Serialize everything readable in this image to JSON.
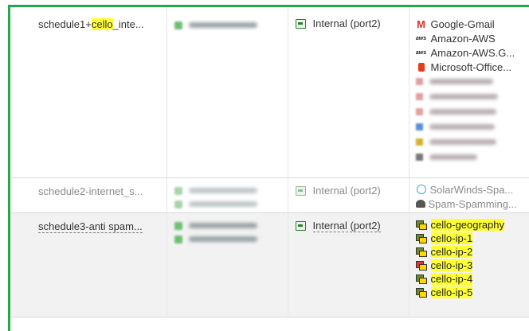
{
  "policies": [
    {
      "name_prefix": "schedule1+",
      "name_highlight": "cello",
      "name_suffix": "_inte...",
      "interface": "Internal (port2)",
      "services": [
        {
          "icon": "gmail-icon",
          "label": "Google-Gmail"
        },
        {
          "icon": "aws-icon",
          "label": "Amazon-AWS"
        },
        {
          "icon": "aws-icon",
          "label": "Amazon-AWS.G..."
        },
        {
          "icon": "office-icon",
          "label": "Microsoft-Office..."
        }
      ]
    },
    {
      "name": "schedule2-internet_s...",
      "interface": "Internal (port2)",
      "services": [
        {
          "icon": "solarwinds-icon",
          "label": "SolarWinds-Spa..."
        },
        {
          "icon": "spam-icon",
          "label": "Spam-Spamming..."
        }
      ]
    },
    {
      "name": "schedule3-anti spam...",
      "interface": "Internal (port2)",
      "addresses": [
        {
          "label": "cello-geography",
          "icon": "address-group-icon"
        },
        {
          "label": "cello-ip-1",
          "icon": "address-group-icon"
        },
        {
          "label": "cello-ip-2",
          "icon": "address-group-icon"
        },
        {
          "label": "cello-ip-3",
          "icon": "address-group-red-icon"
        },
        {
          "label": "cello-ip-4",
          "icon": "address-group-icon"
        },
        {
          "label": "cello-ip-5",
          "icon": "address-group-icon"
        }
      ]
    }
  ],
  "colors": {
    "frame": "#23a84a",
    "highlight": "#ffff33"
  }
}
